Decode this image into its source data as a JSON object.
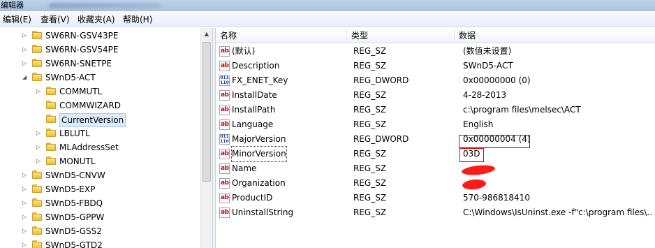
{
  "window": {
    "title": "编辑器"
  },
  "menu": [
    {
      "label": "编辑(E)",
      "name": "menu-edit"
    },
    {
      "label": "查看(V)",
      "name": "menu-view"
    },
    {
      "label": "收藏夹(A)",
      "name": "menu-favorites"
    },
    {
      "label": "帮助(H)",
      "name": "menu-help"
    }
  ],
  "tree": [
    {
      "label": "SW6RN-GSV43PE",
      "expanded": false,
      "selected": false
    },
    {
      "label": "SW6RN-GSV54PE",
      "expanded": false,
      "selected": false
    },
    {
      "label": "SW6RN-SNETPE",
      "expanded": false,
      "selected": false
    },
    {
      "label": "SWnD5-ACT",
      "expanded": true,
      "selected": false
    },
    {
      "label": "COMMUTL",
      "expanded": false,
      "selected": false
    },
    {
      "label": "COMMWIZARD",
      "expanded": false,
      "selected": false
    },
    {
      "label": "CurrentVersion",
      "expanded": false,
      "selected": true
    },
    {
      "label": "LBLUTL",
      "expanded": false,
      "selected": false
    },
    {
      "label": "MLAddressSet",
      "expanded": false,
      "selected": false
    },
    {
      "label": "MONUTL",
      "expanded": false,
      "selected": false
    },
    {
      "label": "SWnD5-CNVW",
      "expanded": false,
      "selected": false
    },
    {
      "label": "SWnD5-EXP",
      "expanded": false,
      "selected": false
    },
    {
      "label": "SWnD5-FBDQ",
      "expanded": false,
      "selected": false
    },
    {
      "label": "SWnD5-GPPW",
      "expanded": false,
      "selected": false
    },
    {
      "label": "SWnD5-GSS2",
      "expanded": false,
      "selected": false
    },
    {
      "label": "SWnD5-GTD2",
      "expanded": false,
      "selected": false
    }
  ],
  "columns": {
    "name": "名称",
    "type": "类型",
    "data": "数据"
  },
  "values": [
    {
      "name": "(默认)",
      "type": "REG_SZ",
      "data": "(数值未设置)",
      "icon": "string-value-icon"
    },
    {
      "name": "Description",
      "type": "REG_SZ",
      "data": "SWnD5-ACT",
      "icon": "string-value-icon"
    },
    {
      "name": "FX_ENET_Key",
      "type": "REG_DWORD",
      "data": "0x00000000 (0)",
      "icon": "dword-value-icon"
    },
    {
      "name": "InstallDate",
      "type": "REG_SZ",
      "data": "4-28-2013",
      "icon": "string-value-icon"
    },
    {
      "name": "InstallPath",
      "type": "REG_SZ",
      "data": "c:\\program files\\melsec\\ACT",
      "icon": "string-value-icon"
    },
    {
      "name": "Language",
      "type": "REG_SZ",
      "data": "English",
      "icon": "string-value-icon"
    },
    {
      "name": "MajorVersion",
      "type": "REG_DWORD",
      "data": "0x00000004 (4)",
      "icon": "dword-value-icon"
    },
    {
      "name": "MinorVersion",
      "type": "REG_SZ",
      "data": "03D",
      "icon": "string-value-icon"
    },
    {
      "name": "Name",
      "type": "REG_SZ",
      "data": "",
      "icon": "string-value-icon"
    },
    {
      "name": "Organization",
      "type": "REG_SZ",
      "data": "",
      "icon": "string-value-icon"
    },
    {
      "name": "ProductID",
      "type": "REG_SZ",
      "data": "570-986818410",
      "icon": "string-value-icon"
    },
    {
      "name": "UninstallString",
      "type": "REG_SZ",
      "data": "C:\\Windows\\IsUninst.exe -f\"c:\\program files\\...",
      "icon": "string-value-icon"
    }
  ],
  "icon_text": {
    "string": "ab",
    "dword": "011 110"
  },
  "colors": {
    "highlight_box": "#e00000",
    "redaction": "#ff1a1a",
    "selection": "#dcebfc"
  }
}
